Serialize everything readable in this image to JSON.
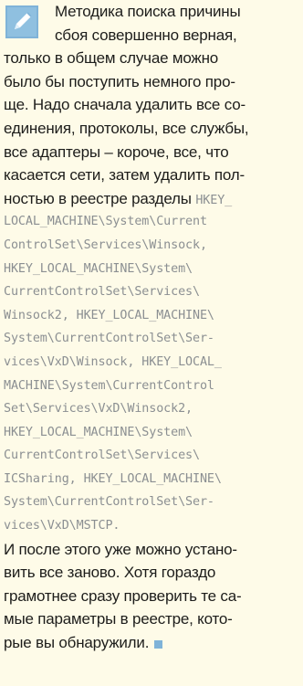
{
  "article": {
    "lines": [
      "Методика поиска причины",
      "сбоя совершенно верная,",
      "только в общем случае можно",
      "было бы поступить немного про-",
      "ще. Надо сначала удалить все со-",
      "единения, протоколы, все службы,",
      "все адаптеры – короче, все, что",
      "касается сети, затем удалить пол-"
    ],
    "mixed_line": {
      "text": "ностью в реестре разделы ",
      "code": "HKEY_"
    },
    "code_lines": [
      "LOCAL_MACHINE\\System\\Current",
      "ControlSet\\Services\\Winsock,",
      "HKEY_LOCAL_MACHINE\\System\\",
      "CurrentControlSet\\Services\\",
      "Winsock2, HKEY_LOCAL_MACHINE\\",
      "System\\CurrentControlSet\\Ser-",
      "vices\\VxD\\Winsock, HKEY_LOCAL_",
      "MACHINE\\System\\CurrentControl",
      "Set\\Services\\VxD\\Winsock2,",
      "HKEY_LOCAL_MACHINE\\System\\",
      "CurrentControlSet\\Services\\",
      "ICSharing, HKEY_LOCAL_MACHINE\\",
      "System\\CurrentControlSet\\Ser-",
      "vices\\VxD\\MSTCP."
    ],
    "closing_lines": [
      "И после этого уже можно устано-",
      "вить все заново. Хотя гораздо",
      "грамотнее сразу проверить те са-",
      "мые параметры в реестре, кото-",
      "рые вы обнаружили."
    ],
    "icon": "pencil-icon",
    "accent_color": "#7fb3d8",
    "code_color": "#8b8f92",
    "end_marker_color": "#7fb3d8"
  }
}
